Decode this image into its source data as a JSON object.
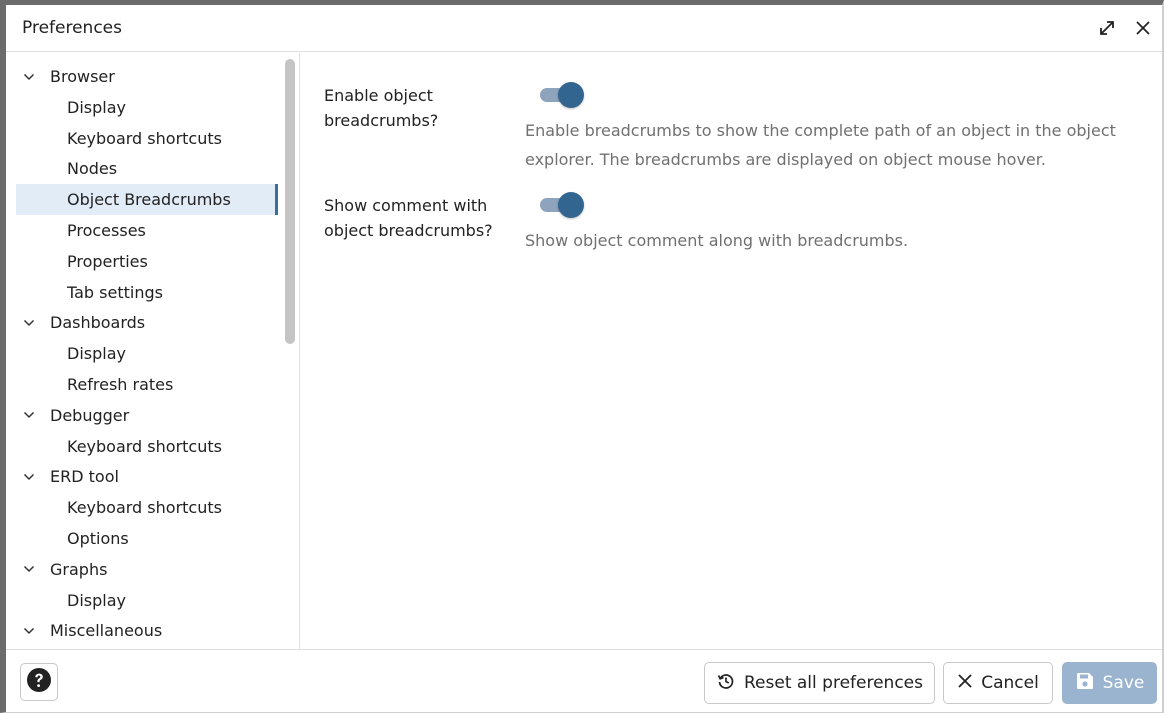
{
  "dialog": {
    "title": "Preferences"
  },
  "tree": {
    "items": [
      {
        "label": "Browser",
        "level": 0,
        "expanded": true
      },
      {
        "label": "Display",
        "level": 1
      },
      {
        "label": "Keyboard shortcuts",
        "level": 1
      },
      {
        "label": "Nodes",
        "level": 1
      },
      {
        "label": "Object Breadcrumbs",
        "level": 1,
        "selected": true
      },
      {
        "label": "Processes",
        "level": 1
      },
      {
        "label": "Properties",
        "level": 1
      },
      {
        "label": "Tab settings",
        "level": 1
      },
      {
        "label": "Dashboards",
        "level": 0,
        "expanded": true
      },
      {
        "label": "Display",
        "level": 1
      },
      {
        "label": "Refresh rates",
        "level": 1
      },
      {
        "label": "Debugger",
        "level": 0,
        "expanded": true
      },
      {
        "label": "Keyboard shortcuts",
        "level": 1
      },
      {
        "label": "ERD tool",
        "level": 0,
        "expanded": true
      },
      {
        "label": "Keyboard shortcuts",
        "level": 1
      },
      {
        "label": "Options",
        "level": 1
      },
      {
        "label": "Graphs",
        "level": 0,
        "expanded": true
      },
      {
        "label": "Display",
        "level": 1
      },
      {
        "label": "Miscellaneous",
        "level": 0,
        "expanded": true
      }
    ]
  },
  "prefs": [
    {
      "label": "Enable object breadcrumbs?",
      "enabled": true,
      "help": "Enable breadcrumbs to show the complete path of an object in the object explorer. The breadcrumbs are displayed on object mouse hover."
    },
    {
      "label": "Show comment with object breadcrumbs?",
      "enabled": true,
      "help": "Show object comment along with breadcrumbs."
    }
  ],
  "footer": {
    "reset_label": "Reset all preferences",
    "cancel_label": "Cancel",
    "save_label": "Save"
  },
  "icons": {
    "maximize": "expand-icon",
    "close": "close-icon",
    "help": "help-icon",
    "reset": "history-icon",
    "cancel": "x-icon",
    "save": "floppy-disk-icon",
    "chevron": "chevron-down-icon"
  },
  "colors": {
    "accent": "#326690",
    "selected_bg": "#e2ecf7",
    "save_disabled": "#9ab4cf"
  }
}
